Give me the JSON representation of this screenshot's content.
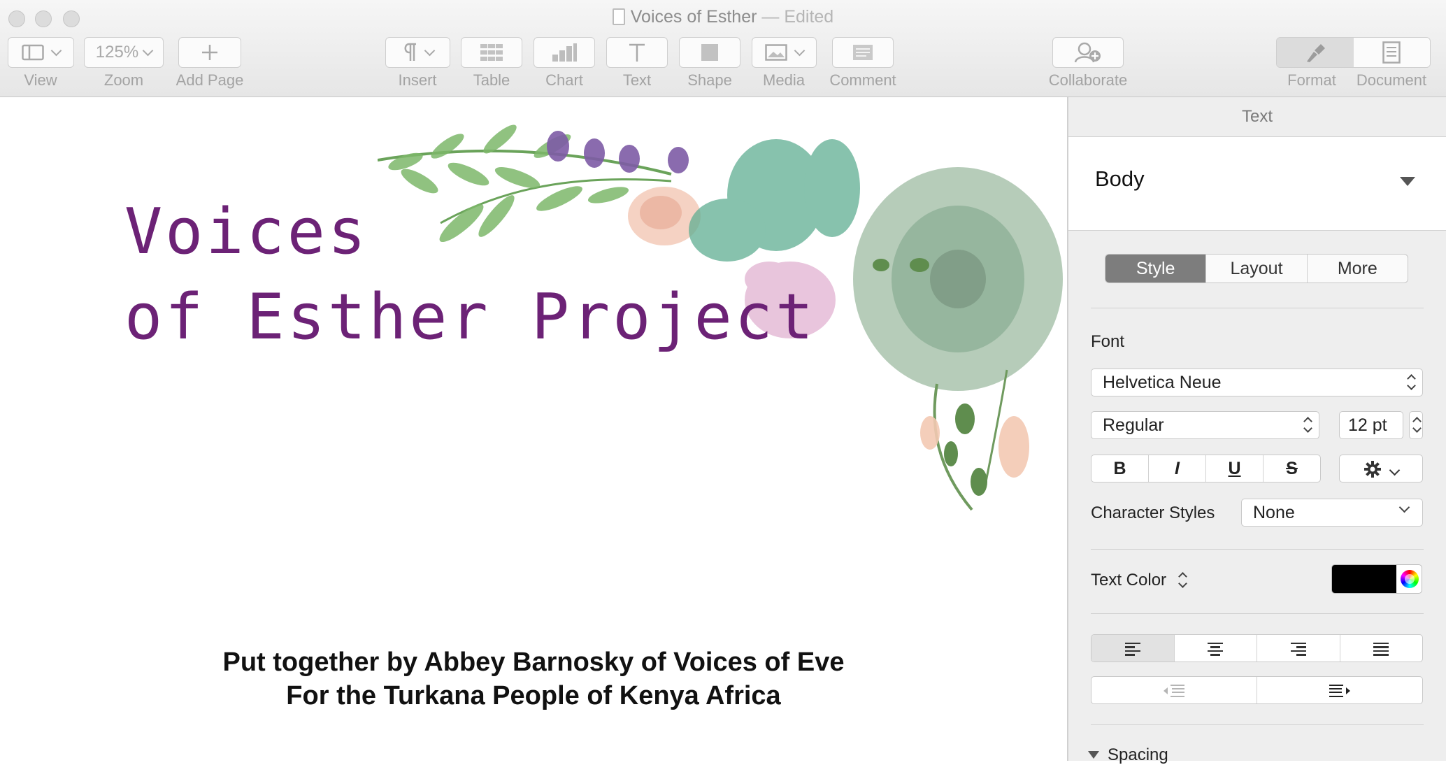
{
  "window": {
    "title": "Voices of Esther",
    "status": "— Edited"
  },
  "toolbar": {
    "view_label": "View",
    "zoom_value": "125%",
    "zoom_label": "Zoom",
    "add_page_label": "Add Page",
    "insert_label": "Insert",
    "table_label": "Table",
    "chart_label": "Chart",
    "text_label": "Text",
    "shape_label": "Shape",
    "media_label": "Media",
    "comment_label": "Comment",
    "collaborate_label": "Collaborate",
    "format_label": "Format",
    "document_label": "Document"
  },
  "document": {
    "title_line1": "Voices",
    "title_line2": "of Esther Project",
    "credit_line1": "Put together by Abbey Barnosky of Voices of Eve",
    "credit_line2": "For the Turkana People of Kenya Africa",
    "title_color": "#6c2276"
  },
  "inspector": {
    "header": "Text",
    "paragraph_style": "Body",
    "tabs": [
      "Style",
      "Layout",
      "More"
    ],
    "active_tab": "Style",
    "font_heading": "Font",
    "font_family": "Helvetica Neue",
    "font_typeface": "Regular",
    "font_size": "12 pt",
    "bold": "B",
    "italic": "I",
    "underline": "U",
    "strike": "S",
    "character_styles_label": "Character Styles",
    "character_styles_value": "None",
    "text_color_label": "Text Color",
    "text_color": "#000000",
    "spacing_label": "Spacing"
  },
  "icons": {
    "view": "sidebar-view-icon",
    "insert": "pilcrow-icon",
    "table": "table-icon",
    "chart": "bar-chart-icon",
    "text": "text-T-icon",
    "shape": "square-shape-icon",
    "media": "image-icon",
    "comment": "comment-icon",
    "collaborate": "collaborate-person-icon",
    "format": "paintbrush-icon",
    "document": "document-icon"
  }
}
